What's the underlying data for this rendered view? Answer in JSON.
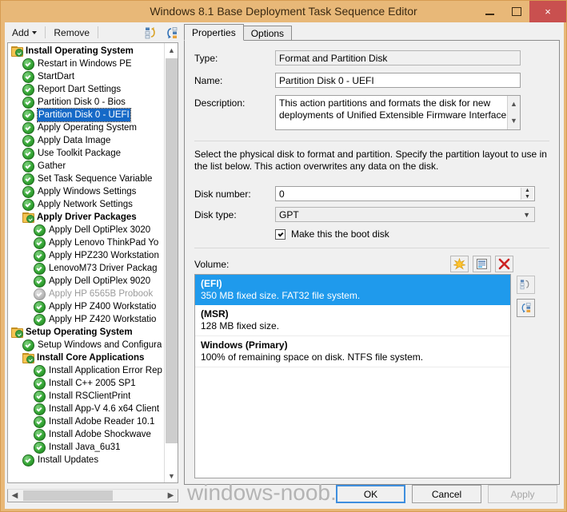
{
  "window": {
    "title": "Windows 8.1 Base Deployment Task Sequence Editor",
    "minimize_label": "Minimize",
    "maximize_label": "Maximize",
    "close_label": "×",
    "titlebar_color": "#e8b878",
    "close_color": "#c9504f"
  },
  "toolbar": {
    "add_label": "Add",
    "remove_label": "Remove",
    "icon1": "move-up-icon",
    "icon2": "move-down-icon"
  },
  "tree": {
    "nodes": [
      {
        "label": "Install Operating System",
        "indent": 0,
        "icon": "folder",
        "group": true
      },
      {
        "label": "Restart in Windows PE",
        "indent": 1,
        "icon": "check"
      },
      {
        "label": "StartDart",
        "indent": 1,
        "icon": "check"
      },
      {
        "label": "Report Dart Settings",
        "indent": 1,
        "icon": "check"
      },
      {
        "label": "Partition Disk 0 - Bios",
        "indent": 1,
        "icon": "check"
      },
      {
        "label": "Partition Disk 0 - UEFI",
        "indent": 1,
        "icon": "check",
        "selected": true
      },
      {
        "label": "Apply Operating System",
        "indent": 1,
        "icon": "check"
      },
      {
        "label": "Apply Data Image",
        "indent": 1,
        "icon": "check"
      },
      {
        "label": "Use Toolkit Package",
        "indent": 1,
        "icon": "check"
      },
      {
        "label": "Gather",
        "indent": 1,
        "icon": "check"
      },
      {
        "label": "Set Task Sequence Variable",
        "indent": 1,
        "icon": "check"
      },
      {
        "label": "Apply Windows Settings",
        "indent": 1,
        "icon": "check"
      },
      {
        "label": "Apply Network Settings",
        "indent": 1,
        "icon": "check"
      },
      {
        "label": "Apply Driver Packages",
        "indent": 1,
        "icon": "folder",
        "group": true
      },
      {
        "label": "Apply Dell OptiPlex 3020",
        "indent": 2,
        "icon": "check"
      },
      {
        "label": "Apply Lenovo ThinkPad Yo",
        "indent": 2,
        "icon": "check"
      },
      {
        "label": "Apply HPZ230 Workstation",
        "indent": 2,
        "icon": "check"
      },
      {
        "label": "LenovoM73 Driver Packag",
        "indent": 2,
        "icon": "check"
      },
      {
        "label": "Apply Dell OptiPlex 9020",
        "indent": 2,
        "icon": "check"
      },
      {
        "label": "Apply HP 6565B Probook",
        "indent": 2,
        "icon": "check-off",
        "disabled": true
      },
      {
        "label": "Apply HP Z400 Workstatio",
        "indent": 2,
        "icon": "check"
      },
      {
        "label": "Apply HP Z420 Workstatio",
        "indent": 2,
        "icon": "check"
      },
      {
        "label": "Setup Operating System",
        "indent": 0,
        "icon": "folder",
        "group": true
      },
      {
        "label": "Setup Windows and Configura",
        "indent": 1,
        "icon": "check"
      },
      {
        "label": "Install Core Applications",
        "indent": 1,
        "icon": "folder",
        "group": true
      },
      {
        "label": "Install Application Error Rep",
        "indent": 2,
        "icon": "check"
      },
      {
        "label": "Install C++ 2005 SP1",
        "indent": 2,
        "icon": "check"
      },
      {
        "label": "Install RSClientPrint",
        "indent": 2,
        "icon": "check"
      },
      {
        "label": "Install App-V 4.6 x64 Client",
        "indent": 2,
        "icon": "check"
      },
      {
        "label": "Install Adobe Reader 10.1",
        "indent": 2,
        "icon": "check"
      },
      {
        "label": "Install Adobe Shockwave",
        "indent": 2,
        "icon": "check"
      },
      {
        "label": "Install Java_6u31",
        "indent": 2,
        "icon": "check"
      },
      {
        "label": "Install Updates",
        "indent": 1,
        "icon": "check"
      }
    ]
  },
  "tabs": [
    {
      "label": "Properties",
      "active": true
    },
    {
      "label": "Options",
      "active": false
    }
  ],
  "properties": {
    "type_label": "Type:",
    "type_value": "Format and Partition Disk",
    "name_label": "Name:",
    "name_value": "Partition Disk 0 - UEFI",
    "description_label": "Description:",
    "description_value": "This action partitions and formats the disk for new deployments of Unified Extensible Firmware Interface",
    "instruction": "Select the physical disk to format and partition. Specify the partition layout to use in the list below. This action overwrites any data on the disk.",
    "disk_number_label": "Disk number:",
    "disk_number_value": "0",
    "disk_type_label": "Disk type:",
    "disk_type_value": "GPT",
    "boot_disk_label": "Make this the boot disk",
    "boot_disk_checked": true,
    "volume_label": "Volume:",
    "volume_buttons": {
      "new": "new-volume-icon",
      "properties": "volume-properties-icon",
      "delete": "delete-volume-icon"
    },
    "side_buttons": {
      "copy": "copy-layout-icon",
      "paste": "paste-layout-icon"
    },
    "volumes": [
      {
        "title": "(EFI)",
        "detail": "350 MB fixed size. FAT32 file system.",
        "selected": true
      },
      {
        "title": "(MSR)",
        "detail": "128 MB fixed size.",
        "selected": false
      },
      {
        "title": "Windows (Primary)",
        "detail": "100% of remaining space on disk. NTFS file system.",
        "selected": false
      }
    ]
  },
  "footer": {
    "ok_label": "OK",
    "cancel_label": "Cancel",
    "apply_label": "Apply",
    "apply_disabled": true
  },
  "watermark": "windows-noob.com"
}
